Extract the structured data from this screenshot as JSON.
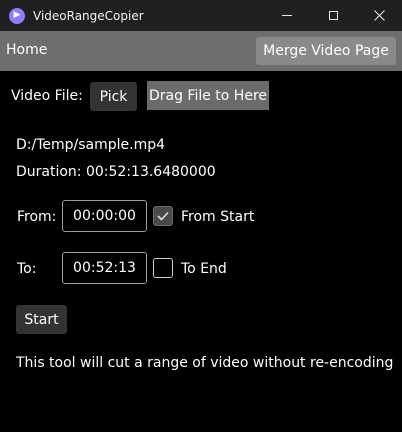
{
  "window": {
    "title": "VideoRangeCopier",
    "icon": "video-copier-app-icon",
    "controls": {
      "minimize": "minimize-icon",
      "maximize": "maximize-icon",
      "close": "close-icon"
    }
  },
  "nav": {
    "home_label": "Home",
    "merge_button_label": "Merge Video Page"
  },
  "file": {
    "label": "Video File:",
    "pick_button_label": "Pick",
    "drop_zone_label": "Drag File to Here",
    "path": "D:/Temp/sample.mp4",
    "duration_text": "Duration: 00:52:13.6480000"
  },
  "range": {
    "from_label": "From:",
    "from_value": "00:00:00",
    "from_start_label": "From Start",
    "from_start_checked": true,
    "to_label": "To:",
    "to_value": "00:52:13",
    "to_end_label": "To End",
    "to_end_checked": false
  },
  "start_button_label": "Start",
  "description": "This tool will cut a range of video without re-encoding",
  "colors": {
    "background": "#000000",
    "titlebar": "#202020",
    "navbar": "#6e6e6e",
    "button_dark": "#333333",
    "drop_zone": "#6b6b6b"
  }
}
